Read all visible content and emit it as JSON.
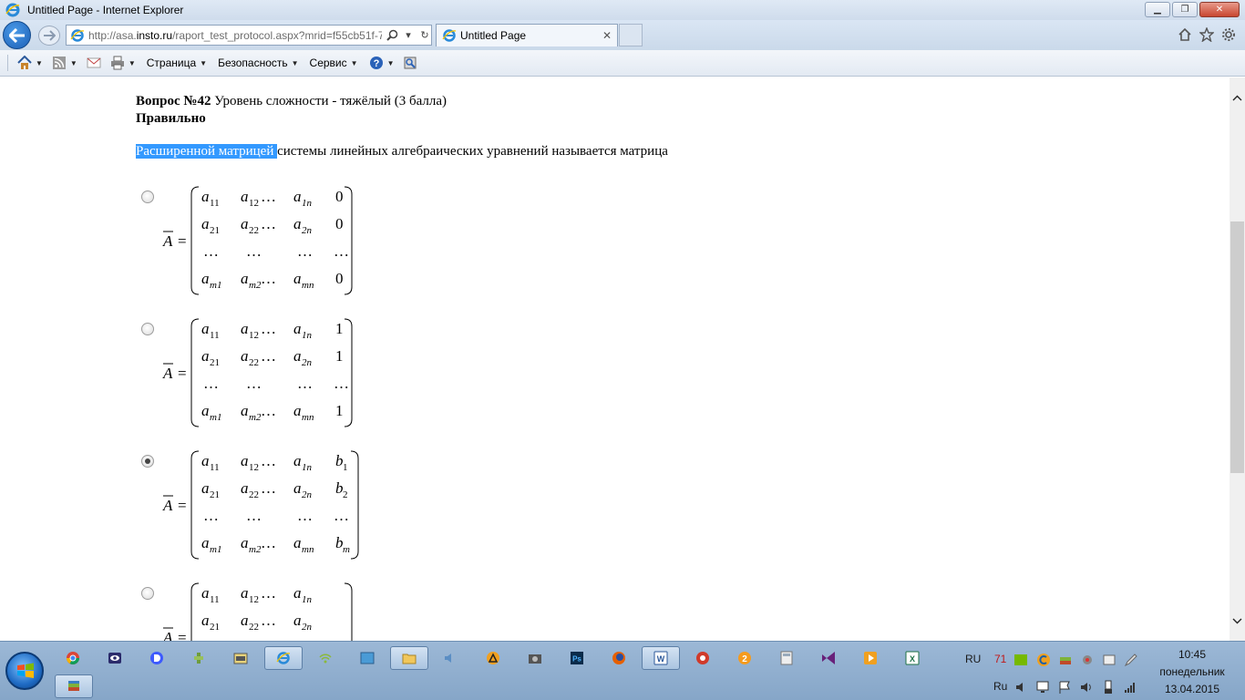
{
  "window": {
    "title": "Untitled Page - Internet Explorer"
  },
  "navbar": {
    "url_prefix": "http://asa.",
    "url_host": "insto.ru",
    "url_rest": "/raport_test_protocol.aspx?mrid=f55cb51f-7",
    "tab_label": "Untitled Page"
  },
  "commandbar": {
    "menu_page": "Страница",
    "menu_security": "Безопасность",
    "menu_service": "Сервис"
  },
  "question": {
    "number_label": "Вопрос №42",
    "difficulty": " Уровень сложности - тяжёлый (3 балла)",
    "status": "Правильно",
    "highlighted": "Расширенной матрицей ",
    "text_rest": "системы линейных алгебраических уравнений называется матрица"
  },
  "options": [
    {
      "selected": false,
      "matrix_label": "A",
      "equals": "=",
      "rows": [
        [
          "a",
          "11",
          "a",
          "12",
          "…",
          "a",
          "1n",
          "0"
        ],
        [
          "a",
          "21",
          "a",
          "22",
          "…",
          "a",
          "2n",
          "0"
        ],
        [
          "…",
          "",
          "…",
          "",
          "",
          "…",
          "",
          "…"
        ],
        [
          "a",
          "m1",
          "a",
          "m2",
          "…",
          "a",
          "mn",
          "0"
        ]
      ]
    },
    {
      "selected": false,
      "matrix_label": "A",
      "equals": "=",
      "rows": [
        [
          "a",
          "11",
          "a",
          "12",
          "…",
          "a",
          "1n",
          "1"
        ],
        [
          "a",
          "21",
          "a",
          "22",
          "…",
          "a",
          "2n",
          "1"
        ],
        [
          "…",
          "",
          "…",
          "",
          "",
          "…",
          "",
          "…"
        ],
        [
          "a",
          "m1",
          "a",
          "m2",
          "…",
          "a",
          "mn",
          "1"
        ]
      ]
    },
    {
      "selected": true,
      "matrix_label": "A",
      "equals": "=",
      "rows": [
        [
          "a",
          "11",
          "a",
          "12",
          "…",
          "a",
          "1n",
          "b₁"
        ],
        [
          "a",
          "21",
          "a",
          "22",
          "…",
          "a",
          "2n",
          "b₂"
        ],
        [
          "…",
          "",
          "…",
          "",
          "",
          "…",
          "",
          "…"
        ],
        [
          "a",
          "m1",
          "a",
          "m2",
          "…",
          "a",
          "mn",
          "bₘ"
        ]
      ]
    },
    {
      "selected": false,
      "matrix_label": "A",
      "equals": "=",
      "rows": [
        [
          "a",
          "11",
          "a",
          "12",
          "…",
          "a",
          "1n",
          ""
        ],
        [
          "a",
          "21",
          "a",
          "22",
          "…",
          "a",
          "2n",
          ""
        ]
      ]
    }
  ],
  "tray": {
    "lang_top": "RU",
    "lang_bottom": "Ru",
    "badge": "71",
    "time": "10:45",
    "weekday": "понедельник",
    "date": "13.04.2015"
  },
  "colors": {
    "highlight": "#3399ff",
    "ie_blue": "#1c5fb5"
  }
}
